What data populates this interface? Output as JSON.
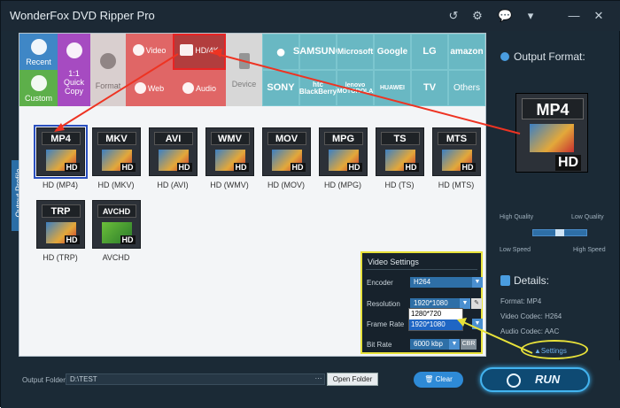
{
  "title": "WonderFox DVD Ripper Pro",
  "window_controls": [
    "↺",
    "⚙",
    "💬",
    "▾",
    "—",
    "✕"
  ],
  "sidebar_tab": "Output Profile",
  "categories": [
    {
      "label": "Recent"
    },
    {
      "label": "Custom"
    },
    {
      "label": "1:1 Quick Copy"
    },
    {
      "label": "Format"
    },
    {
      "label": "Video"
    },
    {
      "label": "HD/4K"
    },
    {
      "label": "Web"
    },
    {
      "label": "Audio"
    },
    {
      "label": "Device"
    }
  ],
  "brands": [
    "",
    "SAMSUNG",
    "Microsoft",
    "Google",
    "LG",
    "amazon",
    "SONY",
    "htc BlackBerry",
    "lenovo MOTOROLA",
    "HUAWEI",
    "TV",
    "Others"
  ],
  "formats": [
    {
      "tag": "MP4",
      "label": "HD (MP4)"
    },
    {
      "tag": "MKV",
      "label": "HD (MKV)"
    },
    {
      "tag": "AVI",
      "label": "HD (AVI)"
    },
    {
      "tag": "WMV",
      "label": "HD (WMV)"
    },
    {
      "tag": "MOV",
      "label": "HD (MOV)"
    },
    {
      "tag": "MPG",
      "label": "HD (MPG)"
    },
    {
      "tag": "TS",
      "label": "HD (TS)"
    },
    {
      "tag": "MTS",
      "label": "HD (MTS)"
    },
    {
      "tag": "TRP",
      "label": "HD (TRP)"
    },
    {
      "tag": "AVCHD",
      "label": "AVCHD"
    }
  ],
  "video_settings": {
    "title": "Video Settings",
    "encoder_label": "Encoder",
    "encoder": "H264",
    "resolution_label": "Resolution",
    "resolution": "1920*1080",
    "framerate_label": "Frame Rate",
    "bitrate_label": "Bit Rate",
    "bitrate": "6000 kbp",
    "options": [
      "1280*720",
      "1920*1080"
    ]
  },
  "output": {
    "label": "Output Format:",
    "tag": "MP4",
    "hd": "HD",
    "high_quality": "High Quality",
    "low_quality": "Low Quality",
    "low_speed": "Low Speed",
    "high_speed": "High Speed",
    "details": "Details:",
    "format": "Format: MP4",
    "vcodec": "Video Codec: H264",
    "acodec": "Audio Codec: AAC",
    "settings": "Settings"
  },
  "bottom": {
    "folder_label": "Output Folder:",
    "folder": "D:\\TEST",
    "open": "Open Folder",
    "clear": "Clear",
    "run": "RUN"
  }
}
